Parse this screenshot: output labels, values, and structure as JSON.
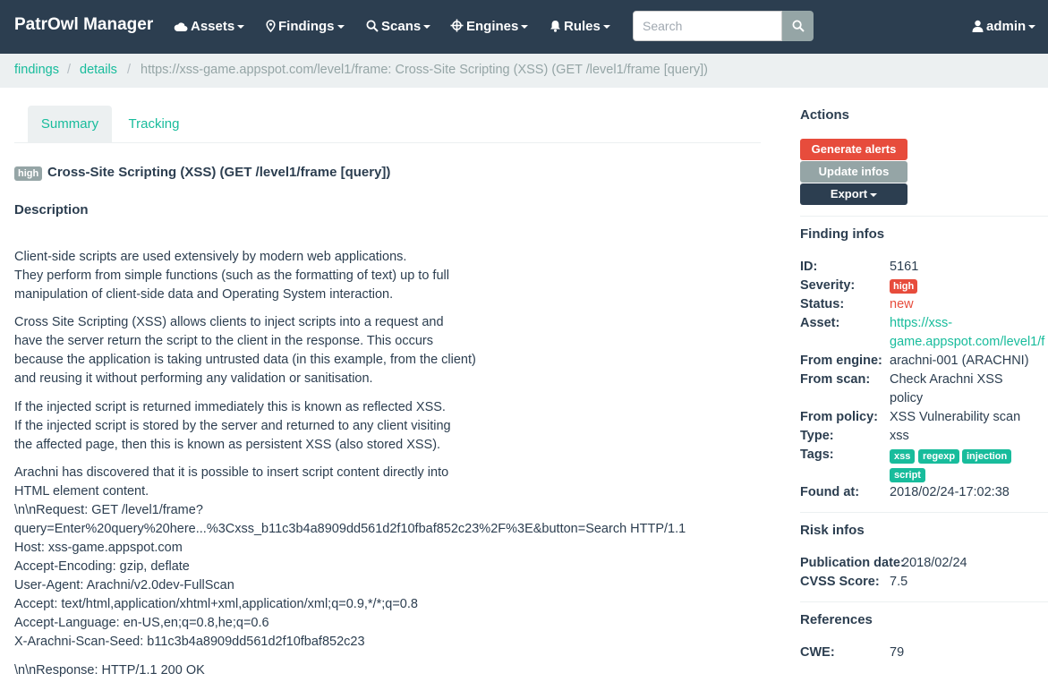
{
  "navbar": {
    "brand": "PatrOwl Manager",
    "menu": [
      "Assets",
      "Findings",
      "Scans",
      "Engines",
      "Rules"
    ],
    "search_placeholder": "Search",
    "user": "admin"
  },
  "breadcrumb": {
    "items": [
      "findings",
      "details"
    ],
    "current": "https://xss-game.appspot.com/level1/frame: Cross-Site Scripting (XSS) (GET /level1/frame [query])"
  },
  "tabs": [
    "Summary",
    "Tracking"
  ],
  "finding": {
    "severity_label": "high",
    "title": "Cross-Site Scripting (XSS) (GET /level1/frame [query])",
    "description_heading": "Description",
    "description_lines": [
      "Client-side scripts are used extensively by modern web applications.",
      "They perform from simple functions (such as the formatting of text) up to full",
      "manipulation of client-side data and Operating System interaction.",
      "Cross Site Scripting (XSS) allows clients to inject scripts into a request and",
      "have the server return the script to the client in the response. This occurs",
      "because the application is taking untrusted data (in this example, from the client)",
      "and reusing it without performing any validation or sanitisation.",
      "If the injected script is returned immediately this is known as reflected XSS.",
      "If the injected script is stored by the server and returned to any client visiting",
      "the affected page, then this is known as persistent XSS (also stored XSS).",
      "Arachni has discovered that it is possible to insert script content directly into",
      "HTML element content.",
      "\\n\\nRequest: GET /level1/frame?",
      "query=Enter%20query%20here...%3Cxss_b11c3b4a8909dd561d2f10fbaf852c23%2F%3E&button=Search HTTP/1.1",
      "Host: xss-game.appspot.com",
      "Accept-Encoding: gzip, deflate",
      "User-Agent: Arachni/v2.0dev-FullScan",
      "Accept: text/html,application/xhtml+xml,application/xml;q=0.9,*/*;q=0.8",
      "Accept-Language: en-US,en;q=0.8,he;q=0.6",
      "X-Arachni-Scan-Seed: b11c3b4a8909dd561d2f10fbaf852c23",
      "\\n\\nResponse: HTTP/1.1 200 OK"
    ]
  },
  "sidebar": {
    "actions_heading": "Actions",
    "buttons": [
      "Generate alerts",
      "Update infos",
      "Export"
    ],
    "finding_infos_heading": "Finding infos",
    "labels": [
      "ID:",
      "Severity:",
      "Status:",
      "Asset:",
      "From engine:",
      "From scan:",
      "From policy:",
      "Type:",
      "Tags:",
      "Found at:"
    ],
    "id": "5161",
    "severity": "high",
    "status": "new",
    "asset_line1": "https://xss-",
    "asset_line2": "game.appspot.com/level1/f",
    "engine": "arachni-001 (ARACHNI)",
    "scan_line1": "Check Arachni XSS",
    "scan_line2": "policy",
    "policy": "XSS Vulnerability scan",
    "type": "xss",
    "tags": [
      "xss",
      "regexp",
      "injection",
      "script"
    ],
    "found_at": "2018/02/24-17:02:38",
    "risk_heading": "Risk infos",
    "publication_label": "Publication date:",
    "publication_date": "2018/02/24",
    "cvss_label": "CVSS Score:",
    "cvss": "7.5",
    "references_heading": "References",
    "cwe_label": "CWE:",
    "cwe": "79"
  },
  "colors": {
    "navbar": "#2c3e50",
    "accent": "#18bc9c",
    "danger": "#e74c3c",
    "muted": "#95a5a6",
    "breadcrumb_bg": "#ecf0f1"
  },
  "icons": {
    "assets": "cloud-icon",
    "findings": "map-marker-icon",
    "scans": "search-icon",
    "engines": "crosshair-icon",
    "rules": "bell-icon",
    "search_button": "search-icon",
    "user": "user-icon"
  }
}
